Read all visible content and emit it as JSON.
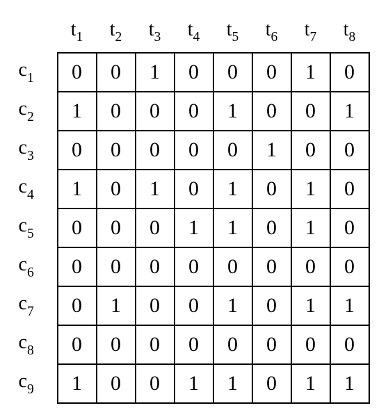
{
  "chart_data": {
    "type": "table",
    "title": "",
    "col_labels": [
      {
        "base": "t",
        "sub": "1"
      },
      {
        "base": "t",
        "sub": "2"
      },
      {
        "base": "t",
        "sub": "3"
      },
      {
        "base": "t",
        "sub": "4"
      },
      {
        "base": "t",
        "sub": "5"
      },
      {
        "base": "t",
        "sub": "6"
      },
      {
        "base": "t",
        "sub": "7"
      },
      {
        "base": "t",
        "sub": "8"
      }
    ],
    "row_labels": [
      {
        "base": "c",
        "sub": "1"
      },
      {
        "base": "c",
        "sub": "2"
      },
      {
        "base": "c",
        "sub": "3"
      },
      {
        "base": "c",
        "sub": "4"
      },
      {
        "base": "c",
        "sub": "5"
      },
      {
        "base": "c",
        "sub": "6"
      },
      {
        "base": "c",
        "sub": "7"
      },
      {
        "base": "c",
        "sub": "8"
      },
      {
        "base": "c",
        "sub": "9"
      }
    ],
    "rows": [
      [
        0,
        0,
        1,
        0,
        0,
        0,
        1,
        0
      ],
      [
        1,
        0,
        0,
        0,
        1,
        0,
        0,
        1
      ],
      [
        0,
        0,
        0,
        0,
        0,
        1,
        0,
        0
      ],
      [
        1,
        0,
        1,
        0,
        1,
        0,
        1,
        0
      ],
      [
        0,
        0,
        0,
        1,
        1,
        0,
        1,
        0
      ],
      [
        0,
        0,
        0,
        0,
        0,
        0,
        0,
        0
      ],
      [
        0,
        1,
        0,
        0,
        1,
        0,
        1,
        1
      ],
      [
        0,
        0,
        0,
        0,
        0,
        0,
        0,
        0
      ],
      [
        1,
        0,
        0,
        1,
        1,
        0,
        1,
        1
      ]
    ]
  }
}
